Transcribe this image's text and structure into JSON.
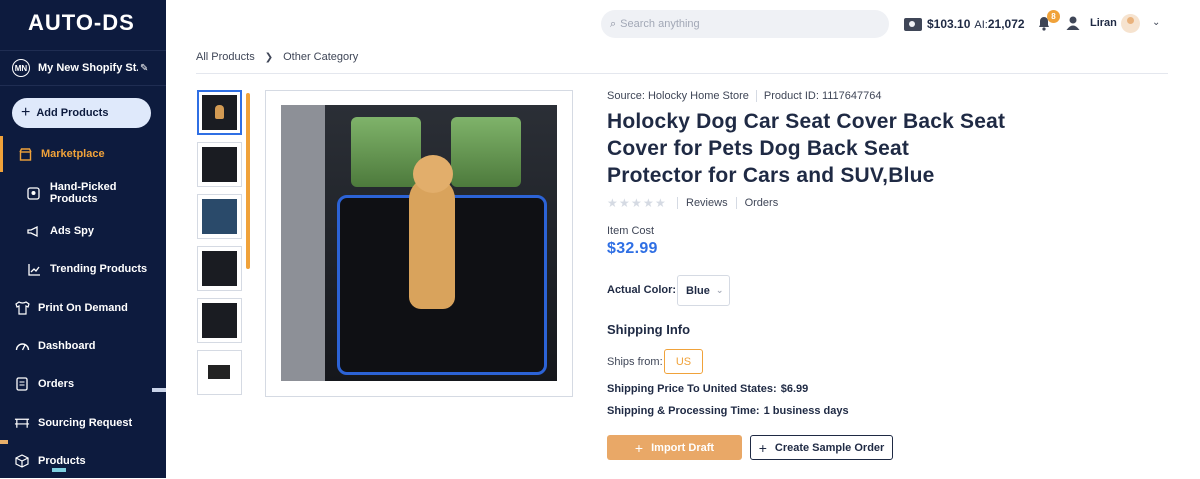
{
  "brand": {
    "logo_text": "AUTO-DS"
  },
  "store": {
    "initials": "MN",
    "name": "My New Shopify St..."
  },
  "sidebar": {
    "add_products": "Add Products",
    "items": [
      {
        "label": "Marketplace",
        "icon": "store-icon",
        "active": true
      },
      {
        "label": "Hand-Picked Products",
        "icon": "hand-picked-icon"
      },
      {
        "label": "Ads Spy",
        "icon": "megaphone-icon"
      },
      {
        "label": "Trending Products",
        "icon": "trend-chart-icon"
      },
      {
        "label": "Print On Demand",
        "icon": "print-shirt-icon"
      },
      {
        "label": "Dashboard",
        "icon": "gauge-icon"
      },
      {
        "label": "Orders",
        "icon": "clipboard-icon"
      },
      {
        "label": "Sourcing Request",
        "icon": "sourcing-icon"
      },
      {
        "label": "Products",
        "icon": "box-icon"
      }
    ]
  },
  "topbar": {
    "search_placeholder": "Search anything",
    "balance": "$103.10",
    "ai_label": "AI:",
    "ai_credits": "21,072",
    "notifications_count": "8",
    "user_name": "Liran"
  },
  "breadcrumb": {
    "items": [
      "All Products",
      "Other Category"
    ]
  },
  "product": {
    "source_label": "Source:",
    "source_store": "Holocky Home Store",
    "id_label": "Product ID:",
    "id": "1117647764",
    "title": "Holocky Dog Car Seat Cover Back Seat Cover for Pets Dog Back Seat Protector for Cars and SUV,Blue",
    "rating": 0,
    "reviews_label": "Reviews",
    "orders_label": "Orders",
    "item_cost_label": "Item Cost",
    "item_cost": "$32.99",
    "actual_color_label": "Actual Color:",
    "actual_color_value": "Blue",
    "shipping_info_label": "Shipping Info",
    "ships_from_label": "Ships from:",
    "ships_from_value": "US",
    "shipping_price_label": "Shipping Price To United States:",
    "shipping_price_value": "$6.99",
    "shipping_time_label": "Shipping & Processing Time:",
    "shipping_time_value": "1 business days",
    "import_button": "Import Draft",
    "sample_button": "Create Sample Order",
    "thumbnail_count": 6
  },
  "colors": {
    "accent_orange": "#f0a23a",
    "accent_blue": "#2f6fe4",
    "sidebar_bg": "#0d1b3e"
  }
}
